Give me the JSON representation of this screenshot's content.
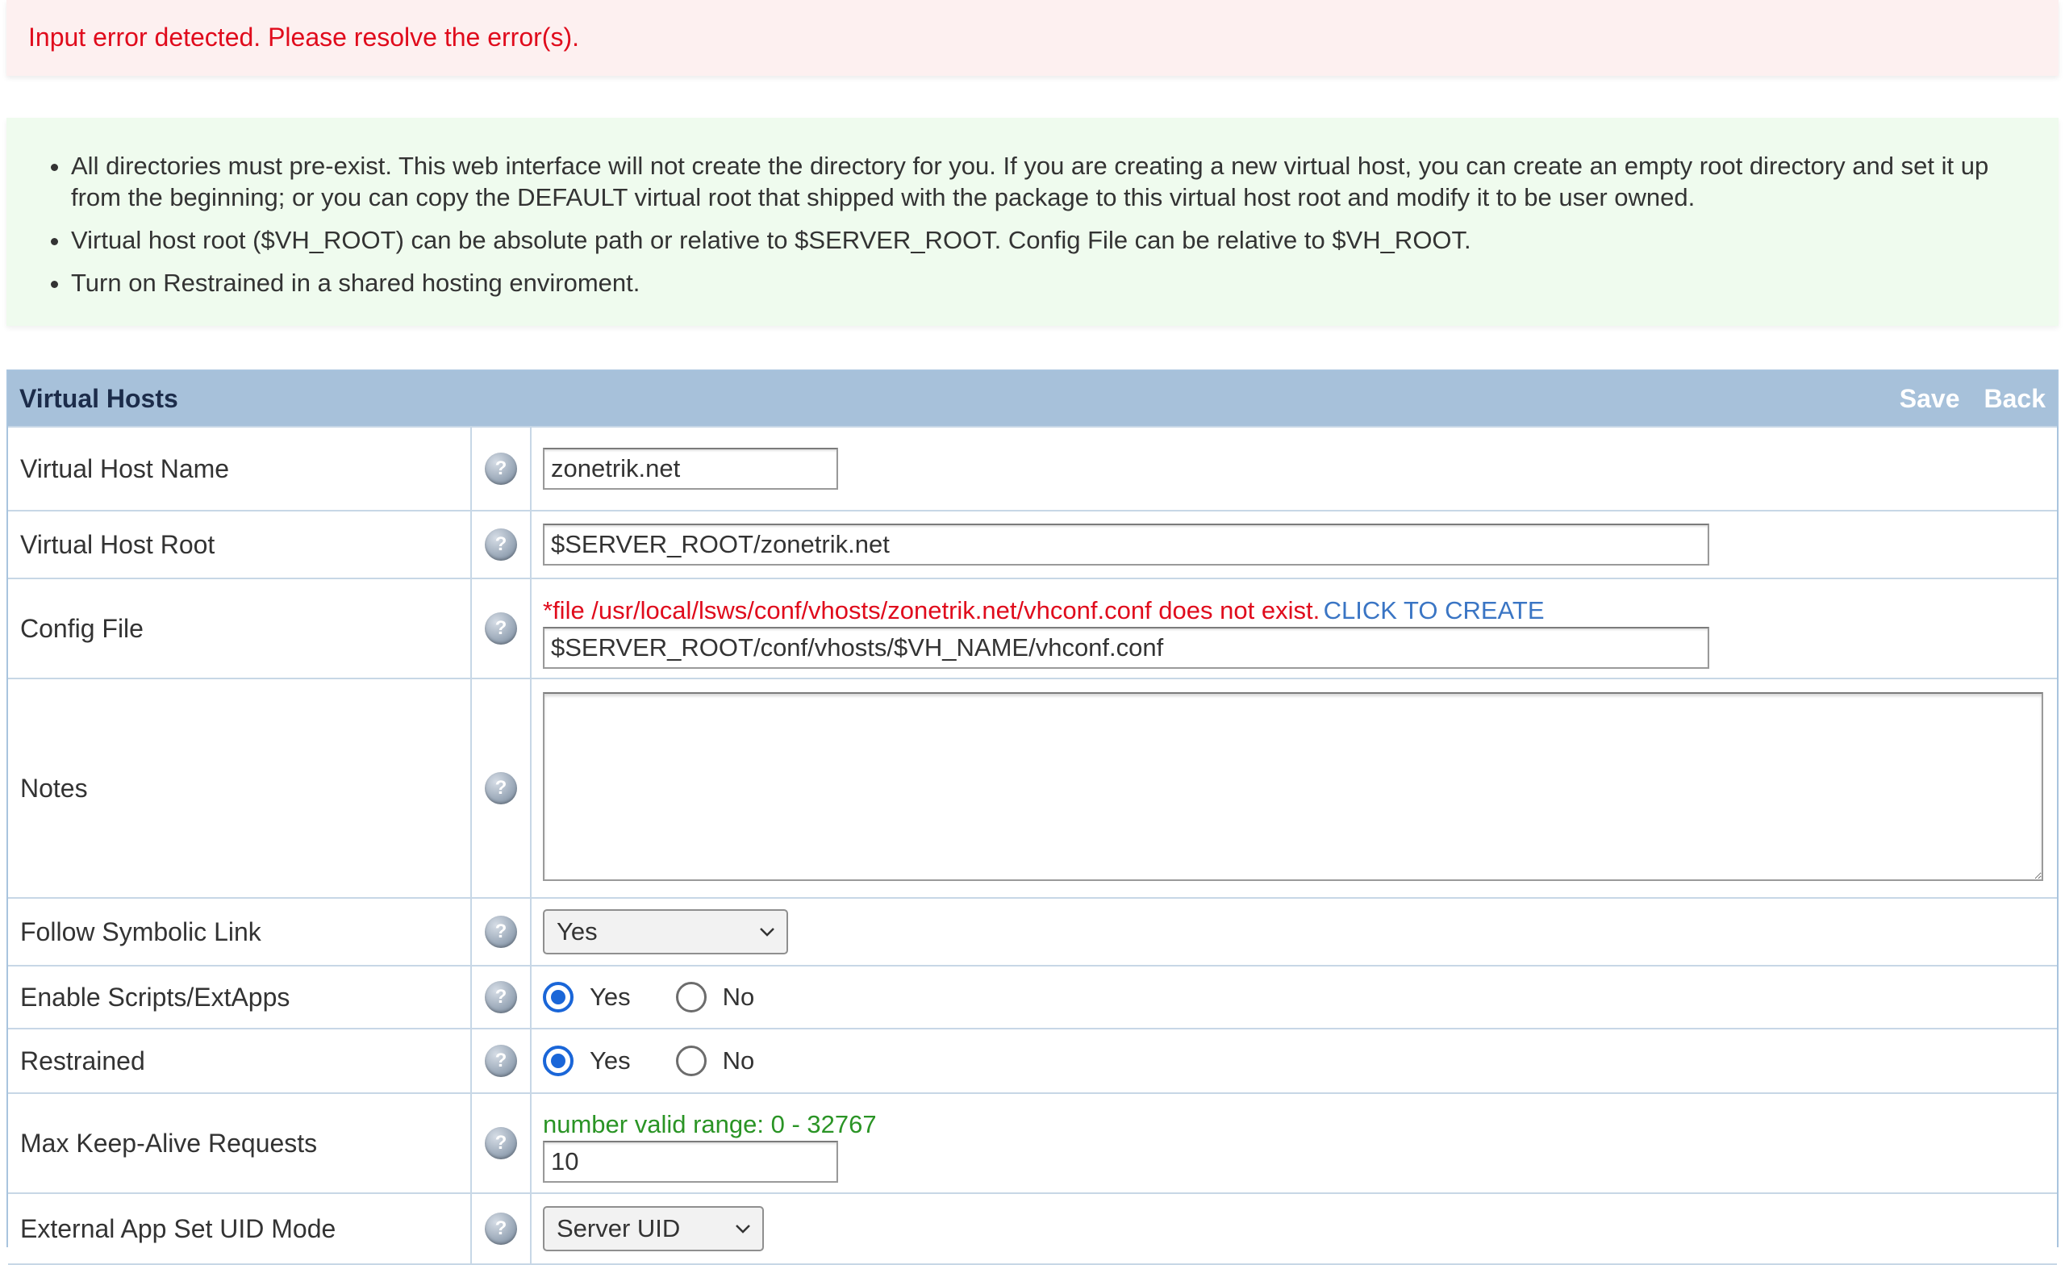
{
  "error_banner": {
    "message": "Input error detected. Please resolve the error(s)."
  },
  "info": {
    "items": [
      "All directories must pre-exist. This web interface will not create the directory for you. If you are creating a new virtual host, you can create an empty root directory and set it up from the beginning; or you can copy the DEFAULT virtual root that shipped with the package to this virtual host root and modify it to be user owned.",
      "Virtual host root ($VH_ROOT) can be absolute path or relative to $SERVER_ROOT. Config File can be relative to $VH_ROOT.",
      "Turn on Restrained in a shared hosting enviroment."
    ]
  },
  "panel": {
    "title": "Virtual Hosts",
    "save_label": "Save",
    "back_label": "Back"
  },
  "rows": {
    "vhost_name": {
      "label": "Virtual Host Name",
      "value": "zonetrik.net"
    },
    "vhost_root": {
      "label": "Virtual Host Root",
      "value": "$SERVER_ROOT/zonetrik.net"
    },
    "config_file": {
      "label": "Config File",
      "error": "*file /usr/local/lsws/conf/vhosts/zonetrik.net/vhconf.conf does not exist.",
      "create_link": "CLICK TO CREATE",
      "value": "$SERVER_ROOT/conf/vhosts/$VH_NAME/vhconf.conf"
    },
    "notes": {
      "label": "Notes",
      "value": ""
    },
    "follow_symlink": {
      "label": "Follow Symbolic Link",
      "selected": "Yes"
    },
    "enable_scripts": {
      "label": "Enable Scripts/ExtApps",
      "yes": "Yes",
      "no": "No",
      "checked": "Yes"
    },
    "restrained": {
      "label": "Restrained",
      "yes": "Yes",
      "no": "No",
      "checked": "Yes"
    },
    "max_keepalive": {
      "label": "Max Keep-Alive Requests",
      "hint": "number valid range: 0 - 32767",
      "value": "10"
    },
    "setuid_mode": {
      "label": "External App Set UID Mode",
      "selected": "Server UID"
    }
  },
  "help_glyph": "?",
  "icons": {
    "help": "help-icon",
    "dropdown": "chevron-down-icon",
    "resize": "resize-handle-icon"
  },
  "colors": {
    "error": "#e00b1c",
    "success": "#2a9425",
    "link": "#3a75c4",
    "header_bg": "#a7c1da",
    "radio_accent": "#1a66d8"
  }
}
